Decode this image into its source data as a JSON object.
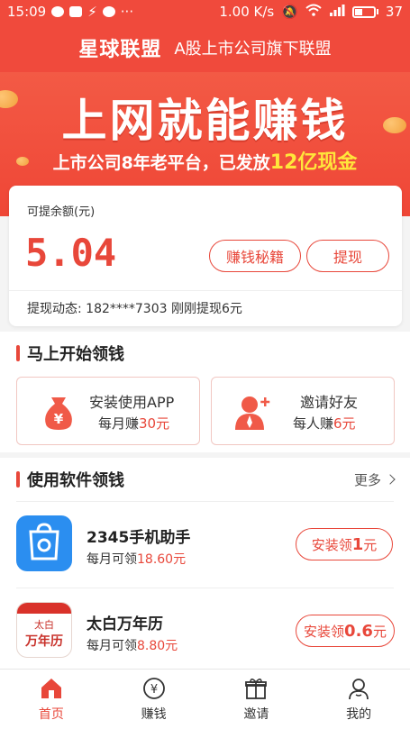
{
  "status_bar": {
    "time": "15:09",
    "speed": "1.00 K/s",
    "battery": "37"
  },
  "header": {
    "logo": "星球联盟",
    "subtitle": "A股上市公司旗下联盟"
  },
  "banner": {
    "title": "上网就能赚钱",
    "slogan_prefix": "上市公司8年老平台，已发放",
    "slogan_highlight": "12亿现金"
  },
  "balance": {
    "label": "可提余额(元)",
    "amount": "5.04",
    "tips_button": "赚钱秘籍",
    "withdraw_button": "提现",
    "feed_label": "提现动态:",
    "feed_text": "182****7303 刚刚提现6元"
  },
  "section_start": {
    "title": "马上开始领钱",
    "tiles": [
      {
        "title": "安装使用APP",
        "prefix": "每月赚",
        "value": "30元",
        "icon": "money-bag-icon"
      },
      {
        "title": "邀请好友",
        "prefix": "每人赚",
        "value": "6元",
        "icon": "invite-person-icon"
      }
    ]
  },
  "section_apps": {
    "title": "使用软件领钱",
    "more": "更多",
    "apps": [
      {
        "name": "2345手机助手",
        "earn_prefix": "每月可领",
        "earn_value": "18.60元",
        "btn_prefix": "安装领",
        "btn_value": "1",
        "btn_suffix": "元"
      },
      {
        "name": "太白万年历",
        "earn_prefix": "每月可领",
        "earn_value": "8.80元",
        "btn_prefix": "安装领",
        "btn_value": "0.6",
        "btn_suffix": "元",
        "icon_small": "太白",
        "icon_big": "万年历"
      }
    ]
  },
  "bottom_nav": [
    {
      "label": "首页",
      "icon": "home-icon",
      "active": true
    },
    {
      "label": "赚钱",
      "icon": "yen-coin-icon",
      "active": false
    },
    {
      "label": "邀请",
      "icon": "gift-icon",
      "active": false
    },
    {
      "label": "我的",
      "icon": "user-icon",
      "active": false
    }
  ],
  "colors": {
    "brand_red": "#f04a3c",
    "accent_red": "#e8473a",
    "highlight_yellow": "#ffe63b",
    "app_blue": "#2b8ef0"
  }
}
